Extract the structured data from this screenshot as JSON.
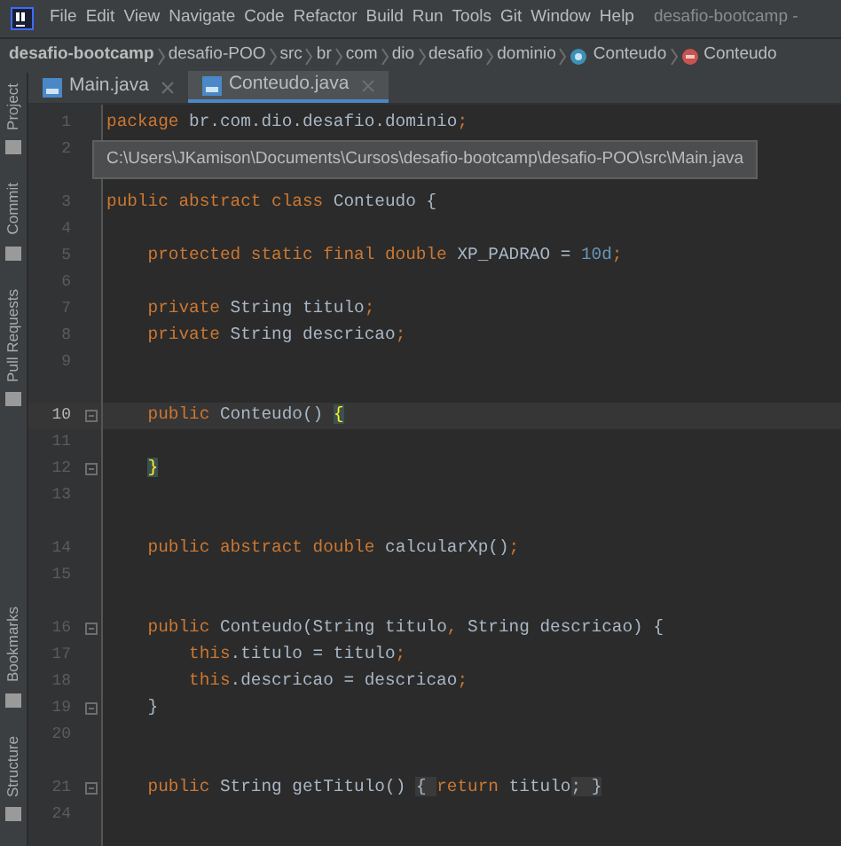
{
  "menu": [
    "File",
    "Edit",
    "View",
    "Navigate",
    "Code",
    "Refactor",
    "Build",
    "Run",
    "Tools",
    "Git",
    "Window",
    "Help"
  ],
  "window": {
    "title": "desafio-bootcamp -"
  },
  "breadcrumb": [
    {
      "kind": "project",
      "label": "desafio-bootcamp"
    },
    {
      "kind": "folder",
      "label": "desafio-POO"
    },
    {
      "kind": "folder",
      "label": "src"
    },
    {
      "kind": "folder",
      "label": "br"
    },
    {
      "kind": "folder",
      "label": "com"
    },
    {
      "kind": "folder",
      "label": "dio"
    },
    {
      "kind": "folder",
      "label": "desafio"
    },
    {
      "kind": "folder",
      "label": "dominio"
    },
    {
      "kind": "class",
      "label": "Conteudo"
    },
    {
      "kind": "method",
      "label": "Conteudo"
    }
  ],
  "tool_strip_top": [
    "Project",
    "Commit",
    "Pull Requests"
  ],
  "tool_strip_bottom": [
    "Bookmarks",
    "Structure"
  ],
  "tabs": [
    {
      "label": "Main.java",
      "selected": false
    },
    {
      "label": "Conteudo.java",
      "selected": true
    }
  ],
  "tooltip": "C:\\Users\\JKamison\\Documents\\Cursos\\desafio-bootcamp\\desafio-POO\\src\\Main.java",
  "lines": [
    {
      "number": "1",
      "spaced_above": false,
      "current": false,
      "fold": false,
      "tokens": [
        {
          "kind": "kw",
          "text": "package"
        },
        {
          "kind": "id",
          "text": " br.com.dio.desafio.dominio"
        },
        {
          "kind": "punct",
          "text": ";"
        }
      ]
    },
    {
      "number": "2",
      "spaced_above": false,
      "current": false,
      "fold": false
    },
    {
      "number": "3",
      "spaced_above": true,
      "current": false,
      "fold": false,
      "tokens": [
        {
          "kind": "kw",
          "text": "public abstract class"
        },
        {
          "kind": "id",
          "text": " Conteudo {"
        }
      ]
    },
    {
      "number": "4",
      "spaced_above": false,
      "current": false,
      "fold": false
    },
    {
      "number": "5",
      "spaced_above": false,
      "current": false,
      "fold": false,
      "tokens": [
        {
          "kind": "kw",
          "text": "    protected static final double"
        },
        {
          "kind": "id",
          "text": " XP_PADRAO = "
        },
        {
          "kind": "num",
          "text": "10d"
        },
        {
          "kind": "punct",
          "text": ";"
        }
      ]
    },
    {
      "number": "6",
      "spaced_above": false,
      "current": false,
      "fold": false
    },
    {
      "number": "7",
      "spaced_above": false,
      "current": false,
      "fold": false,
      "tokens": [
        {
          "kind": "kw",
          "text": "    private"
        },
        {
          "kind": "id",
          "text": " String titulo"
        },
        {
          "kind": "punct",
          "text": ";"
        }
      ]
    },
    {
      "number": "8",
      "spaced_above": false,
      "current": false,
      "fold": false,
      "tokens": [
        {
          "kind": "kw",
          "text": "    private"
        },
        {
          "kind": "id",
          "text": " String descricao"
        },
        {
          "kind": "punct",
          "text": ";"
        }
      ]
    },
    {
      "number": "9",
      "spaced_above": false,
      "current": false,
      "fold": false
    },
    {
      "number": "10",
      "spaced_above": true,
      "current": true,
      "fold": true,
      "tokens": [
        {
          "kind": "kw",
          "text": "    public"
        },
        {
          "kind": "id",
          "text": " Conteudo() "
        },
        {
          "kind": "match",
          "text": "{"
        }
      ]
    },
    {
      "number": "11",
      "spaced_above": false,
      "current": false,
      "fold": false
    },
    {
      "number": "12",
      "spaced_above": false,
      "current": false,
      "fold": true,
      "tokens": [
        {
          "kind": "match",
          "text": "    }"
        }
      ]
    },
    {
      "number": "13",
      "spaced_above": false,
      "current": false,
      "fold": false
    },
    {
      "number": "14",
      "spaced_above": true,
      "current": false,
      "fold": false,
      "tokens": [
        {
          "kind": "kw",
          "text": "    public abstract double"
        },
        {
          "kind": "id",
          "text": " calcularXp()"
        },
        {
          "kind": "punct",
          "text": ";"
        }
      ]
    },
    {
      "number": "15",
      "spaced_above": false,
      "current": false,
      "fold": false
    },
    {
      "number": "16",
      "spaced_above": true,
      "current": false,
      "fold": true,
      "tokens": [
        {
          "kind": "kw",
          "text": "    public"
        },
        {
          "kind": "id",
          "text": " Conteudo(String titulo"
        },
        {
          "kind": "punct",
          "text": ","
        },
        {
          "kind": "id",
          "text": " String descricao) {"
        }
      ]
    },
    {
      "number": "17",
      "spaced_above": false,
      "current": false,
      "fold": false,
      "tokens": [
        {
          "kind": "kw",
          "text": "        this"
        },
        {
          "kind": "id",
          "text": ".titulo = titulo"
        },
        {
          "kind": "punct",
          "text": ";"
        }
      ]
    },
    {
      "number": "18",
      "spaced_above": false,
      "current": false,
      "fold": false,
      "tokens": [
        {
          "kind": "kw",
          "text": "        this"
        },
        {
          "kind": "id",
          "text": ".descricao = descricao"
        },
        {
          "kind": "punct",
          "text": ";"
        }
      ]
    },
    {
      "number": "19",
      "spaced_above": false,
      "current": false,
      "fold": true,
      "tokens": [
        {
          "kind": "id",
          "text": "    }"
        }
      ]
    },
    {
      "number": "20",
      "spaced_above": false,
      "current": false,
      "fold": false
    },
    {
      "number": "21",
      "spaced_above": true,
      "current": false,
      "fold": true,
      "tokens": [
        {
          "kind": "kw",
          "text": "    public"
        },
        {
          "kind": "id",
          "text": " String getTitulo() "
        },
        {
          "kind": "folded",
          "text": "{ "
        },
        {
          "kind": "kw",
          "text": "return"
        },
        {
          "kind": "id",
          "text": " titulo"
        },
        {
          "kind": "folded",
          "text": "; }"
        }
      ]
    },
    {
      "number": "24",
      "spaced_above": false,
      "current": false,
      "fold": false
    }
  ]
}
